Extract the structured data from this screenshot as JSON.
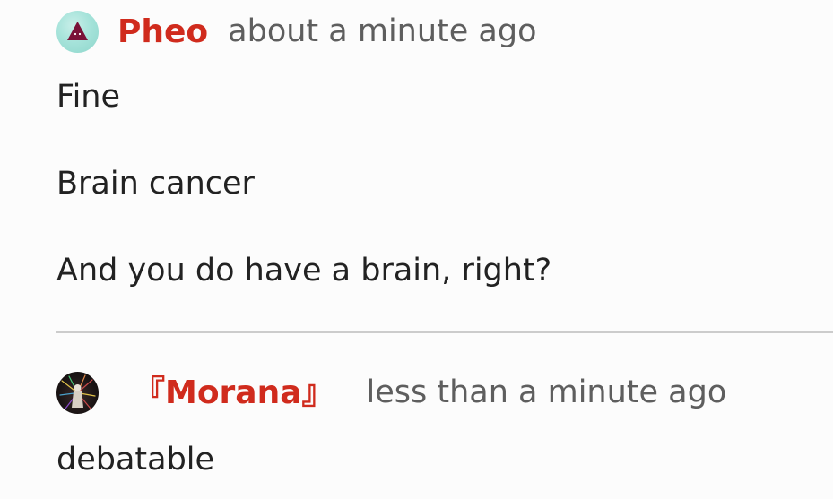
{
  "posts": [
    {
      "username": "Pheo",
      "timestamp": "about a minute ago",
      "avatar_icon": "triangle-avatar-icon",
      "lines": [
        "Fine",
        "Brain cancer",
        "And you do have a brain, right?"
      ]
    },
    {
      "username": "『Morana』",
      "timestamp": "less than a minute ago",
      "avatar_icon": "figure-avatar-icon",
      "lines": [
        "debatable"
      ]
    }
  ],
  "colors": {
    "username": "#d02b1d",
    "timestamp": "#5e5e5e",
    "text": "#222222",
    "divider": "#cccccc",
    "background": "#fcfcfc"
  }
}
